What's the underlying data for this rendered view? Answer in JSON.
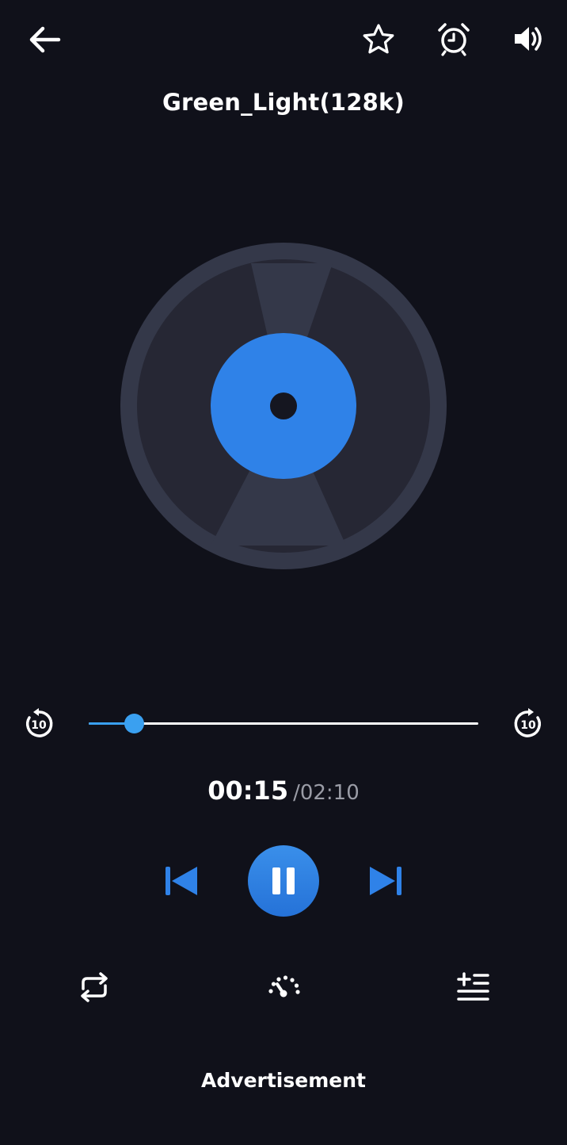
{
  "header": {
    "back_icon": "arrow-left-icon",
    "favorite_icon": "star-icon",
    "timer_icon": "alarm-clock-icon",
    "volume_icon": "speaker-icon",
    "title": "Green_Light(128k)"
  },
  "artwork": {
    "icon": "vinyl-disc-icon",
    "accent_color": "#2f82e8"
  },
  "seek": {
    "rewind_icon": "rewind-10-icon",
    "rewind_label": "10",
    "forward_icon": "forward-10-icon",
    "forward_label": "10",
    "progress_fraction": 0.115,
    "accent_color": "#3aa0f0"
  },
  "time": {
    "current": "00:15",
    "total": "/02:10"
  },
  "controls": {
    "previous_icon": "skip-previous-icon",
    "play_pause_icon": "pause-icon",
    "next_icon": "skip-next-icon",
    "accent_color": "#2f82e8"
  },
  "bottom_bar": {
    "repeat_icon": "repeat-icon",
    "speed_icon": "speedometer-icon",
    "queue_icon": "add-to-playlist-icon"
  },
  "ad": {
    "label": "Advertisement"
  }
}
